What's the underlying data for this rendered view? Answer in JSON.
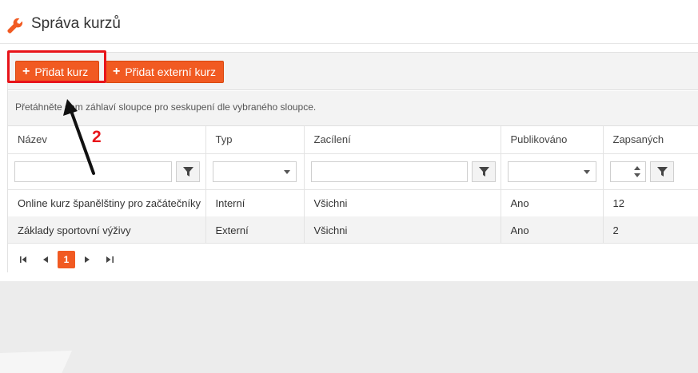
{
  "header": {
    "title": "Správa kurzů",
    "icon": "wrench-icon"
  },
  "toolbar": {
    "add_course_label": "Přidat kurz",
    "add_external_label": "Přidat externí kurz",
    "button_color": "#f15a22"
  },
  "grid": {
    "group_hint": "Přetáhněte sem záhlaví sloupce pro seskupení dle vybraného sloupce.",
    "columns": [
      "Název",
      "Typ",
      "Zacílení",
      "Publikováno",
      "Zapsaných"
    ],
    "rows": [
      [
        "Online kurz španělštiny pro začátečníky",
        "Interní",
        "Všichni",
        "Ano",
        "12"
      ],
      [
        "Základy sportovní výživy",
        "Externí",
        "Všichni",
        "Ano",
        "2"
      ]
    ]
  },
  "pager": {
    "current_page": "1",
    "first_icon": "first-page-icon",
    "prev_icon": "prev-page-icon",
    "next_icon": "next-page-icon",
    "last_icon": "last-page-icon"
  },
  "annotation": {
    "step_number": "2",
    "highlight_color": "#e8141a"
  }
}
